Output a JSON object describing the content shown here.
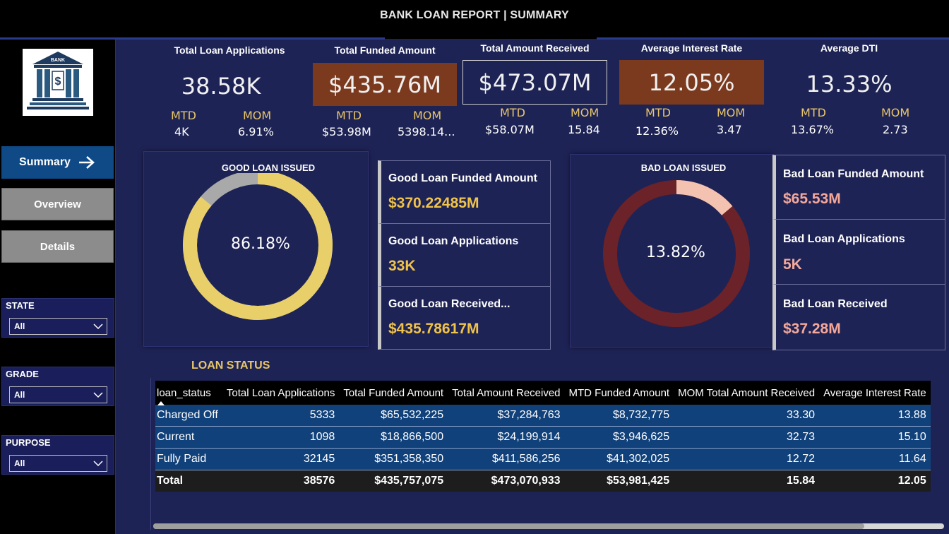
{
  "header": {
    "title": "BANK LOAN REPORT | SUMMARY"
  },
  "logo": {
    "text": "BANK",
    "symbol": "$"
  },
  "nav": {
    "summary": "Summary",
    "overview": "Overview",
    "details": "Details"
  },
  "filters": [
    {
      "label": "STATE",
      "value": "All"
    },
    {
      "label": "GRADE",
      "value": "All"
    },
    {
      "label": "PURPOSE",
      "value": "All"
    }
  ],
  "kpis": [
    {
      "label": "Total Loan Applications",
      "value": "38.58K",
      "mtd_label": "MTD",
      "mtd": "4K",
      "mom_label": "MOM",
      "mom": "6.91%"
    },
    {
      "label": "Total Funded Amount",
      "value": "$435.76M",
      "mtd_label": "MTD",
      "mtd": "$53.98M",
      "mom_label": "MOM",
      "mom": "5398.14..."
    },
    {
      "label": "Total Amount Received",
      "value": "$473.07M",
      "mtd_label": "MTD",
      "mtd": "$58.07M",
      "mom_label": "MOM",
      "mom": "15.84"
    },
    {
      "label": "Average Interest Rate",
      "value": "12.05%",
      "mtd_label": "MTD",
      "mtd": "12.36%",
      "mom_label": "MOM",
      "mom": "3.47"
    },
    {
      "label": "Average DTI",
      "value": "13.33%",
      "mtd_label": "MTD",
      "mtd": "13.67%",
      "mom_label": "MOM",
      "mom": "2.73"
    }
  ],
  "good_loan": {
    "title": "GOOD LOAN ISSUED",
    "percent_label": "86.18%",
    "percent": 86.18,
    "colors": {
      "main": "#e8cf6a",
      "rest": "#a9a9a9"
    },
    "cards": [
      {
        "title": "Good Loan Funded Amount",
        "value": "$370.22485M"
      },
      {
        "title": "Good Loan Applications",
        "value": "33K"
      },
      {
        "title": "Good Loan Received...",
        "value": "$435.78617M"
      }
    ]
  },
  "bad_loan": {
    "title": "BAD LOAN ISSUED",
    "percent_label": "13.82%",
    "percent": 13.82,
    "colors": {
      "main": "#f4c2b0",
      "rest": "#6b2228"
    },
    "cards": [
      {
        "title": "Bad Loan Funded Amount",
        "value": "$65.53M"
      },
      {
        "title": "Bad Loan Applications",
        "value": "5K"
      },
      {
        "title": "Bad Loan Received",
        "value": "$37.28M"
      }
    ]
  },
  "loan_status": {
    "title": "LOAN STATUS",
    "columns": [
      "loan_status",
      "Total Loan Applications",
      "Total Funded Amount",
      "Total Amount Received",
      "MTD Funded Amount",
      "MOM Total Amount Received",
      "Average Interest Rate"
    ],
    "rows": [
      [
        "Charged Off",
        "5333",
        "$65,532,225",
        "$37,284,763",
        "$8,732,775",
        "33.30",
        "13.88"
      ],
      [
        "Current",
        "1098",
        "$18,866,500",
        "$24,199,914",
        "$3,946,625",
        "32.73",
        "15.10"
      ],
      [
        "Fully Paid",
        "32145",
        "$351,358,350",
        "$411,586,256",
        "$41,302,025",
        "12.72",
        "11.64"
      ]
    ],
    "total": [
      "Total",
      "38576",
      "$435,757,075",
      "$473,070,933",
      "$53,981,425",
      "15.84",
      "12.05"
    ]
  }
}
